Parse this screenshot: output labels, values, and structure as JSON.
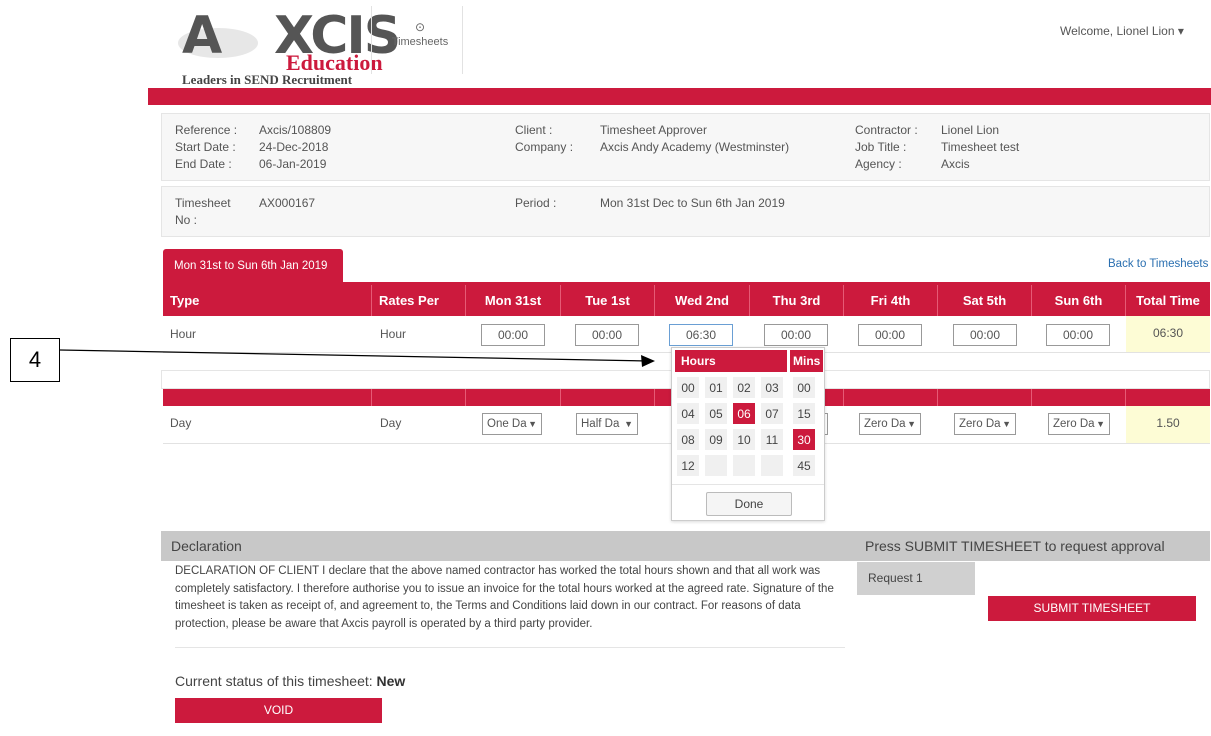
{
  "brand": {
    "logo_main_left": "A",
    "logo_main_right": "XCIS",
    "logo_sub": "Education",
    "tagline": "Leaders in SEND Recruitment"
  },
  "nav": {
    "timesheets": "Timesheets",
    "welcome": "Welcome, Lionel Lion ▾"
  },
  "info": {
    "reference_label": "Reference :",
    "reference": "Axcis/108809",
    "start_label": "Start Date :",
    "start": "24-Dec-2018",
    "end_label": "End Date :",
    "end": "06-Jan-2019",
    "client_label": "Client :",
    "client": "Timesheet Approver",
    "company_label": "Company :",
    "company": "Axcis Andy Academy (Westminster)",
    "contractor_label": "Contractor :",
    "contractor": "Lionel Lion",
    "jobtitle_label": "Job Title :",
    "jobtitle": "Timesheet test",
    "agency_label": "Agency :",
    "agency": "Axcis",
    "tsno_label_1": "Timesheet",
    "tsno_label_2": "No :",
    "tsno": "AX000167",
    "period_label": "Period :",
    "period": "Mon 31st Dec to Sun 6th Jan 2019"
  },
  "tab": {
    "label": "Mon 31st to Sun 6th Jan 2019",
    "back": "Back to Timesheets"
  },
  "table": {
    "headers": [
      "Type",
      "Rates Per",
      "Mon 31st",
      "Tue 1st",
      "Wed 2nd",
      "Thu 3rd",
      "Fri 4th",
      "Sat 5th",
      "Sun 6th",
      "Total Time"
    ],
    "hour_row": {
      "type": "Hour",
      "rate": "Hour",
      "values": [
        "00:00",
        "00:00",
        "06:30",
        "00:00",
        "00:00",
        "00:00",
        "00:00"
      ],
      "total": "06:30"
    },
    "day_row": {
      "type": "Day",
      "rate": "Day",
      "mon": "One Da",
      "tue": "Half Da",
      "fri": "Zero Da",
      "sat": "Zero Da",
      "sun": "Zero Da",
      "total": "1.50"
    }
  },
  "picker": {
    "hours_label": "Hours",
    "mins_label": "Mins",
    "hours": [
      "00",
      "01",
      "02",
      "03",
      "04",
      "05",
      "06",
      "07",
      "08",
      "09",
      "10",
      "11",
      "12"
    ],
    "mins": [
      "00",
      "15",
      "30",
      "45"
    ],
    "selected_hour": "06",
    "selected_min": "30",
    "done": "Done"
  },
  "annotation": {
    "number": "4"
  },
  "declaration": {
    "title": "Declaration",
    "text": "DECLARATION OF CLIENT I declare that the above named contractor has worked the total hours shown and that all work was completely satisfactory. I therefore authorise you to issue an invoice for the total hours worked at the agreed rate. Signature of the timesheet is taken as receipt of, and agreement to, the Terms and Conditions laid down in our contract. For reasons of data protection, please be aware that Axcis payroll is operated by a third party provider.",
    "press": "Press SUBMIT TIMESHEET to request approval",
    "request_label": "Request 1",
    "submit": "SUBMIT TIMESHEET",
    "status_label": "Current status of this timesheet:",
    "status_value": "New",
    "void": "VOID"
  },
  "colors": {
    "accent": "#cc1a3d",
    "link": "#2a6fb0",
    "total_bg": "#fdfcd5"
  }
}
